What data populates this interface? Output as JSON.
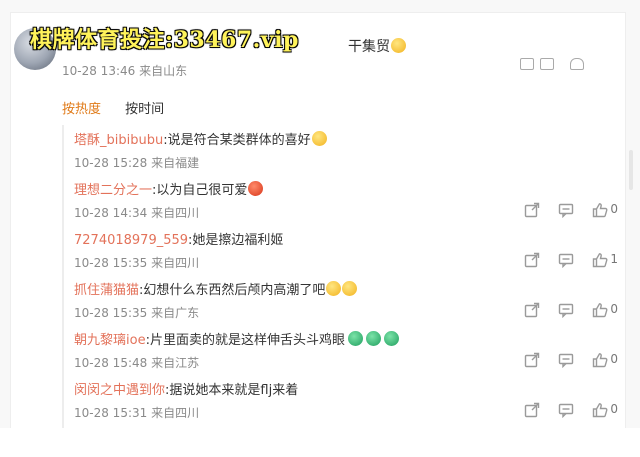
{
  "top_comment": {
    "promo_text": "棋牌体育投注:33467.vip",
    "tail_text": "干集贸",
    "meta": "10-28 13:46 来自山东"
  },
  "tabs": {
    "hot": "按热度",
    "time": "按时间"
  },
  "replies": [
    {
      "author": "塔酥_bibibubu",
      "text": ":说是符合某类群体的喜好",
      "meta": "10-28 15:28 来自福建",
      "likes": "",
      "emojis": [
        "emoji-yellow"
      ]
    },
    {
      "author": "理想二分之一",
      "text": ":以为自己很可爱",
      "meta": "10-28 14:34 来自四川",
      "likes": "0",
      "emojis": [
        "emoji-red"
      ]
    },
    {
      "author": "7274018979_559",
      "text": ":她是擦边福利姬",
      "meta": "10-28 15:35 来自四川",
      "likes": "1",
      "emojis": []
    },
    {
      "author": "抓住蒲猫猫",
      "text": ":幻想什么东西然后颅内高潮了吧",
      "meta": "10-28 15:35 来自广东",
      "likes": "0",
      "emojis": [
        "emoji-yellow",
        "emoji-yellow"
      ]
    },
    {
      "author": "朝九黎璃ioe",
      "text": ":片里面卖的就是这样伸舌头斗鸡眼",
      "meta": "10-28 15:48 来自江苏",
      "likes": "0",
      "emojis": [
        "emoji-green",
        "emoji-green",
        "emoji-green"
      ]
    },
    {
      "author": "闵闵之中遇到你",
      "text": ":据说她本来就是flj来着",
      "meta": "10-28 15:31 来自四川",
      "likes": "0",
      "emojis": []
    }
  ],
  "icons": {
    "share": "share-icon",
    "comment": "comment-icon",
    "like": "thumbs-up-icon"
  },
  "colors": {
    "author": "#e3725a",
    "hot_tab": "#e07a18",
    "promo": "#fff35a"
  }
}
